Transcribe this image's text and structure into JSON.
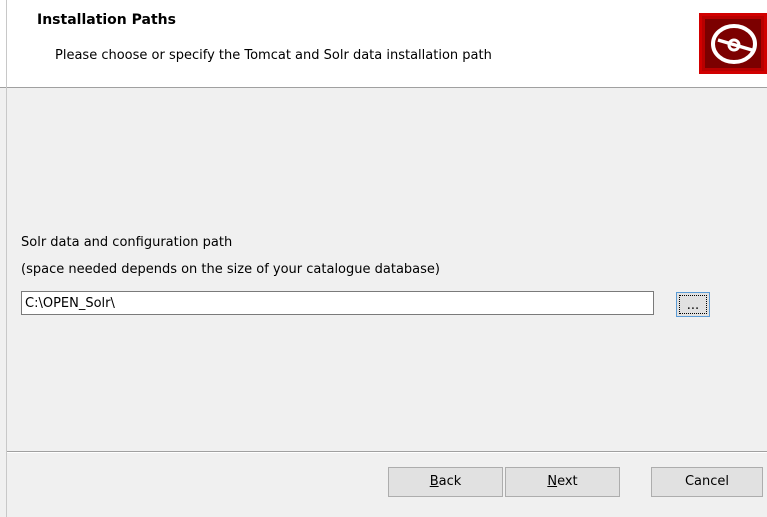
{
  "header": {
    "title": "Installation Paths",
    "subtitle": "Please choose or specify the Tomcat and Solr data installation path",
    "logo_icon": "disc-icon",
    "logo_color": "#b80000"
  },
  "main": {
    "path_label": "Solr data and configuration path",
    "space_note": "(space needed depends on the size of your catalogue database)",
    "path_value": "C:\\OPEN_Solr\\",
    "browse_label": "..."
  },
  "footer": {
    "back": {
      "accel": "B",
      "rest": "ack"
    },
    "next": {
      "accel": "N",
      "rest": "ext"
    },
    "cancel": "Cancel"
  }
}
